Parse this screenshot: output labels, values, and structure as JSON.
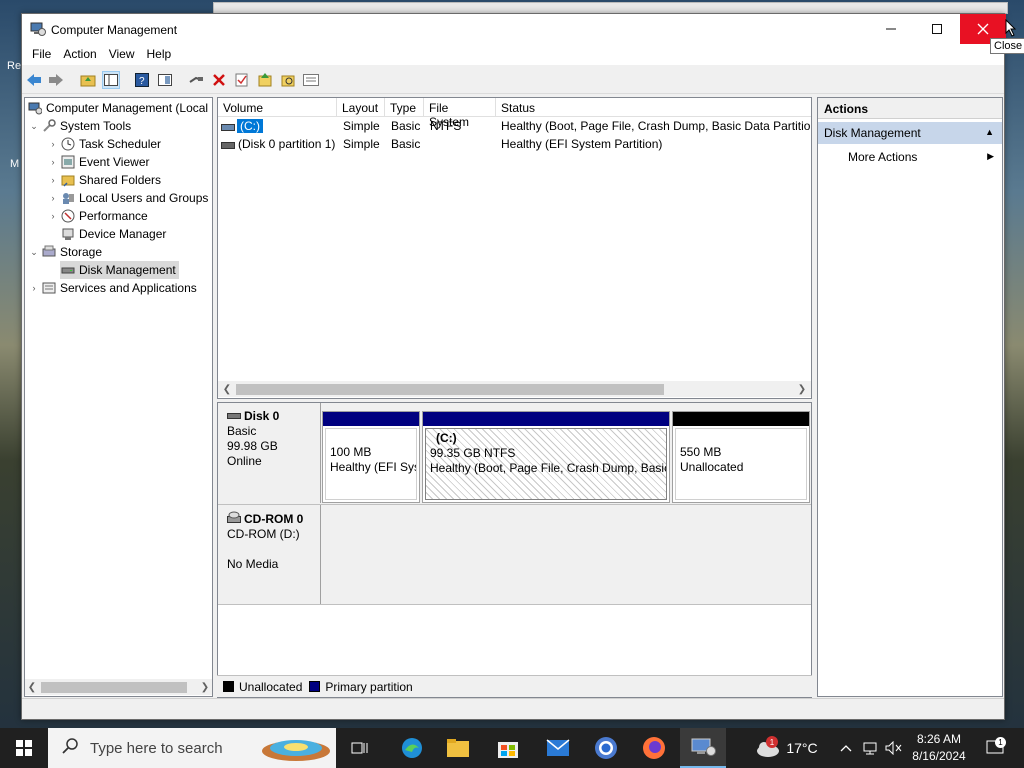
{
  "desktop": {
    "left_label_1": "Re",
    "left_label_2": "M"
  },
  "window": {
    "title": "Computer Management",
    "tooltip": "Close"
  },
  "menu": [
    "File",
    "Action",
    "View",
    "Help"
  ],
  "toolbar_icons": [
    "back-arrow-icon",
    "forward-arrow-icon",
    "up-folder-icon",
    "show-hide-tree-icon",
    "help-icon",
    "console-icon",
    "connect-icon",
    "delete-icon",
    "check-icon",
    "export-icon",
    "search-folder-icon",
    "properties-icon"
  ],
  "tree": {
    "root": "Computer Management (Local",
    "system_tools": "System Tools",
    "task_scheduler": "Task Scheduler",
    "event_viewer": "Event Viewer",
    "shared_folders": "Shared Folders",
    "local_users": "Local Users and Groups",
    "performance": "Performance",
    "device_manager": "Device Manager",
    "storage": "Storage",
    "disk_management": "Disk Management",
    "services_apps": "Services and Applications"
  },
  "volumes": {
    "headers": [
      "Volume",
      "Layout",
      "Type",
      "File System",
      "Status"
    ],
    "rows": [
      {
        "volume": "(C:)",
        "layout": "Simple",
        "type": "Basic",
        "fs": "NTFS",
        "status": "Healthy (Boot, Page File, Crash Dump, Basic Data Partition)"
      },
      {
        "volume": "(Disk 0 partition 1)",
        "layout": "Simple",
        "type": "Basic",
        "fs": "",
        "status": "Healthy (EFI System Partition)"
      }
    ]
  },
  "disks": {
    "disk0": {
      "name": "Disk 0",
      "type": "Basic",
      "size": "99.98 GB",
      "state": "Online",
      "partitions": [
        {
          "title": "",
          "size": "100 MB",
          "status": "Healthy (EFI Sys",
          "color": "#000080"
        },
        {
          "title": "(C:)",
          "size": "99.35 GB NTFS",
          "status": "Healthy (Boot, Page File, Crash Dump, Basic",
          "color": "#000080"
        },
        {
          "title": "",
          "size": "550 MB",
          "status": "Unallocated",
          "color": "#000000"
        }
      ]
    },
    "cdrom0": {
      "name": "CD-ROM 0",
      "drive": "CD-ROM (D:)",
      "media": "No Media"
    }
  },
  "legend": [
    {
      "label": "Unallocated",
      "color": "#000000"
    },
    {
      "label": "Primary partition",
      "color": "#000080"
    }
  ],
  "actions": {
    "header": "Actions",
    "section": "Disk Management",
    "more": "More Actions"
  },
  "taskbar": {
    "search_placeholder": "Type here to search",
    "weather": "17°C",
    "time": "8:26 AM",
    "date": "8/16/2024",
    "notifications": "1",
    "weather_badge": "1"
  }
}
